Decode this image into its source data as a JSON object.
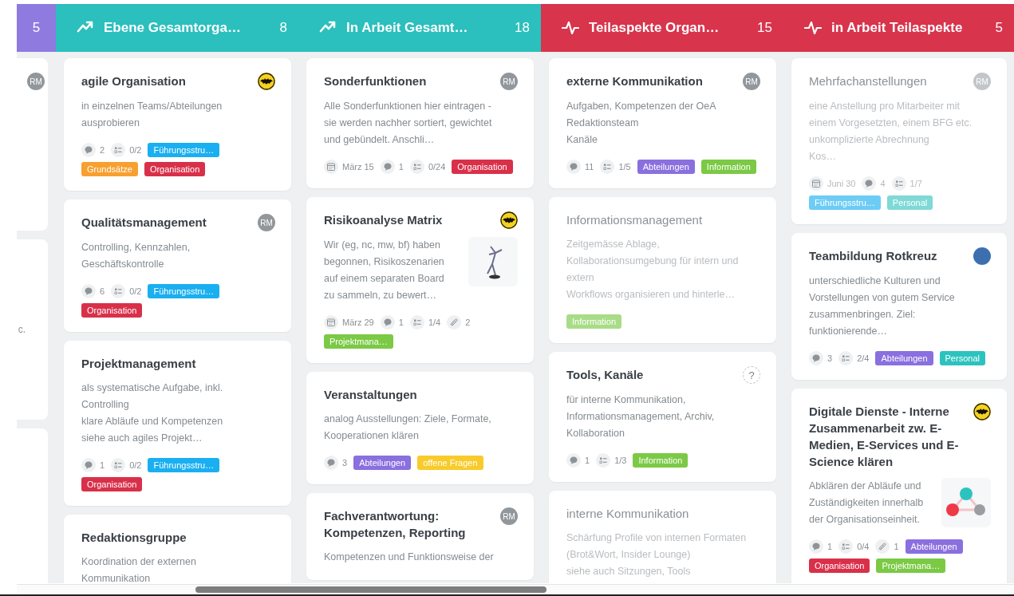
{
  "stub_column": {
    "count": "5",
    "color": "#8f7ae0",
    "cards": [
      {
        "avatar": {
          "kind": "initials",
          "text": "RM"
        }
      },
      {
        "text": "c."
      }
    ]
  },
  "columns": [
    {
      "kind": "trend",
      "color": "#2bbfbd",
      "title": "Ebene Gesamtorga…",
      "count": "8",
      "cards": [
        {
          "title": "agile Organisation",
          "faded": false,
          "avatar": {
            "kind": "bat"
          },
          "description": "in einzelnen Teams/Abteilungen\nausprobieren",
          "meta": [
            {
              "kind": "comments",
              "text": "2"
            },
            {
              "kind": "checklist",
              "text": "0/2"
            }
          ],
          "tags": [
            {
              "label": "Führungsstru…",
              "color": "#1aaff0"
            },
            {
              "label": "Grundsätze",
              "color": "#f7a030"
            },
            {
              "label": "Organisation",
              "color": "#d9304a"
            }
          ]
        },
        {
          "title": "Qualitätsmanagement",
          "faded": false,
          "avatar": {
            "kind": "initials",
            "text": "RM"
          },
          "description": "Controlling, Kennzahlen,\nGeschäftskontrolle",
          "meta": [
            {
              "kind": "comments",
              "text": "6"
            },
            {
              "kind": "checklist",
              "text": "0/2"
            }
          ],
          "tags": [
            {
              "label": "Führungsstru…",
              "color": "#1aaff0"
            },
            {
              "label": "Organisation",
              "color": "#d9304a"
            }
          ]
        },
        {
          "title": "Projektmanagement",
          "faded": false,
          "description": "als systematische Aufgabe, inkl.\nControlling\nklare Abläufe und Kompetenzen\nsiehe auch agiles Projekt…",
          "meta": [
            {
              "kind": "comments",
              "text": "1"
            },
            {
              "kind": "checklist",
              "text": "0/2"
            }
          ],
          "tags": [
            {
              "label": "Führungsstru…",
              "color": "#1aaff0"
            },
            {
              "label": "Organisation",
              "color": "#d9304a"
            }
          ]
        },
        {
          "title": "Redaktionsgruppe",
          "faded": false,
          "description": "Koordination der externen\nKommunikation"
        }
      ]
    },
    {
      "kind": "trend",
      "color": "#2bbfbd",
      "title": "In Arbeit Gesamt…",
      "count": "18",
      "cards": [
        {
          "title": "Sonderfunktionen",
          "faded": false,
          "avatar": {
            "kind": "initials",
            "text": "RM"
          },
          "description": "Alle Sonderfunktionen hier eintragen -\nsie werden nachher sortiert, gewichtet\nund gebündelt. Anschli…",
          "meta": [
            {
              "kind": "date",
              "text": "März 15"
            },
            {
              "kind": "comments",
              "text": "1"
            },
            {
              "kind": "checklist",
              "text": "0/24"
            }
          ],
          "tags": [
            {
              "label": "Organisation",
              "color": "#d9304a"
            }
          ]
        },
        {
          "title": "Risikoanalyse Matrix",
          "faded": false,
          "avatar": {
            "kind": "bat"
          },
          "kind": "figure",
          "description": "Wir (eg, nc, mw, bf) haben\nbegonnen, Risikoszenarien\nauf einem separaten Board\nzu sammeln, zu bewert…",
          "meta": [
            {
              "kind": "date",
              "text": "März 29"
            },
            {
              "kind": "comments",
              "text": "1"
            },
            {
              "kind": "checklist",
              "text": "1/4"
            },
            {
              "kind": "attachments",
              "text": "2"
            }
          ],
          "tags": [
            {
              "label": "Projektmana…",
              "color": "#7bc945"
            }
          ]
        },
        {
          "title": "Veranstaltungen",
          "faded": false,
          "description": "analog Ausstellungen: Ziele, Formate,\nKooperationen klären",
          "meta": [
            {
              "kind": "comments",
              "text": "3"
            }
          ],
          "tags": [
            {
              "label": "Abteilungen",
              "color": "#8a6fdf"
            },
            {
              "label": "offene Fragen",
              "color": "#f8cb2b"
            }
          ]
        },
        {
          "title": "Fachverantwortung:\nKompetenzen, Reporting",
          "faded": false,
          "avatar": {
            "kind": "initials",
            "text": "RM"
          },
          "description": "Kompetenzen und Funktionsweise der"
        }
      ]
    },
    {
      "kind": "pulse",
      "color": "#d8344c",
      "title": "Teilaspekte Organ…",
      "count": "15",
      "cards": [
        {
          "title": "externe Kommunikation",
          "faded": false,
          "avatar": {
            "kind": "initials",
            "text": "RM"
          },
          "description": "Aufgaben, Kompetenzen der OeA\nRedaktionsteam\nKanäle",
          "meta": [
            {
              "kind": "comments",
              "text": "11"
            },
            {
              "kind": "checklist",
              "text": "1/5"
            }
          ],
          "tags": [
            {
              "label": "Abteilungen",
              "color": "#8a6fdf"
            },
            {
              "label": "Information",
              "color": "#7bc945"
            }
          ]
        },
        {
          "title": "Informationsmanagement",
          "faded": true,
          "description": "Zeitgemässe Ablage,\nKollaborationsumgebung für intern und\nextern\nWorkflows organisieren und hinterle…",
          "tags": [
            {
              "label": "Information",
              "color": "#a9dc88"
            }
          ]
        },
        {
          "title": "Tools, Kanäle",
          "faded": false,
          "avatar": {
            "kind": "question",
            "text": "?"
          },
          "description": "für interne Kommunikation,\nInformationsmanagement, Archiv,\nKollaboration",
          "meta": [
            {
              "kind": "comments",
              "text": "1"
            },
            {
              "kind": "checklist",
              "text": "1/3"
            }
          ],
          "tags": [
            {
              "label": "Information",
              "color": "#7bc945"
            }
          ]
        },
        {
          "title": "interne Kommunikation",
          "faded": true,
          "description": "Schärfung Profile von internen Formaten\n(Brot&Wort, Insider Lounge)\nsiehe auch Sitzungen, Tools"
        }
      ]
    },
    {
      "kind": "pulse",
      "color": "#d8344c",
      "title": "in Arbeit Teilaspekte",
      "count": "5",
      "cards": [
        {
          "title": "Mehrfachanstellungen",
          "faded": true,
          "avatar": {
            "kind": "initials",
            "text": "RM"
          },
          "description": "eine Anstellung pro Mitarbeiter mit\neinem Vorgesetzten, einem BFG etc.\nunkomplizierte Abrechnung\nKos…",
          "meta": [
            {
              "kind": "date",
              "text": "Juni 30"
            },
            {
              "kind": "comments",
              "text": "4"
            },
            {
              "kind": "checklist",
              "text": "1/7"
            }
          ],
          "tags": [
            {
              "label": "Führungsstru…",
              "color": "#6cccf5"
            },
            {
              "label": "Personal",
              "color": "#7fd9d6"
            }
          ]
        },
        {
          "title": "Teambildung Rotkreuz",
          "faded": false,
          "avatar": {
            "kind": "photo"
          },
          "description": "unterschiedliche Kulturen und\nVorstellungen von gutem Service\nzusammenbringen. Ziel:\nfunktionierende…",
          "meta": [
            {
              "kind": "comments",
              "text": "3"
            },
            {
              "kind": "checklist",
              "text": "2/4"
            }
          ],
          "tags": [
            {
              "label": "Abteilungen",
              "color": "#8a6fdf"
            },
            {
              "label": "Personal",
              "color": "#2cc3bf"
            }
          ]
        },
        {
          "title": "Digitale Dienste - Interne\nZusammenarbeit zw. E-\nMedien, E-Services und E-\nScience klären",
          "faded": false,
          "avatar": {
            "kind": "bat"
          },
          "kind": "diagram",
          "description": "Abklären der Abläufe und\nZuständigkeiten innerhalb\nder Organisationseinheit.",
          "meta": [
            {
              "kind": "comments",
              "text": "1"
            },
            {
              "kind": "checklist",
              "text": "0/4"
            },
            {
              "kind": "attachments",
              "text": "1"
            }
          ],
          "tags": [
            {
              "label": "Abteilungen",
              "color": "#8a6fdf"
            },
            {
              "label": "Organisation",
              "color": "#d9304a"
            },
            {
              "label": "Projektmana…",
              "color": "#7bc945"
            }
          ]
        }
      ]
    }
  ]
}
